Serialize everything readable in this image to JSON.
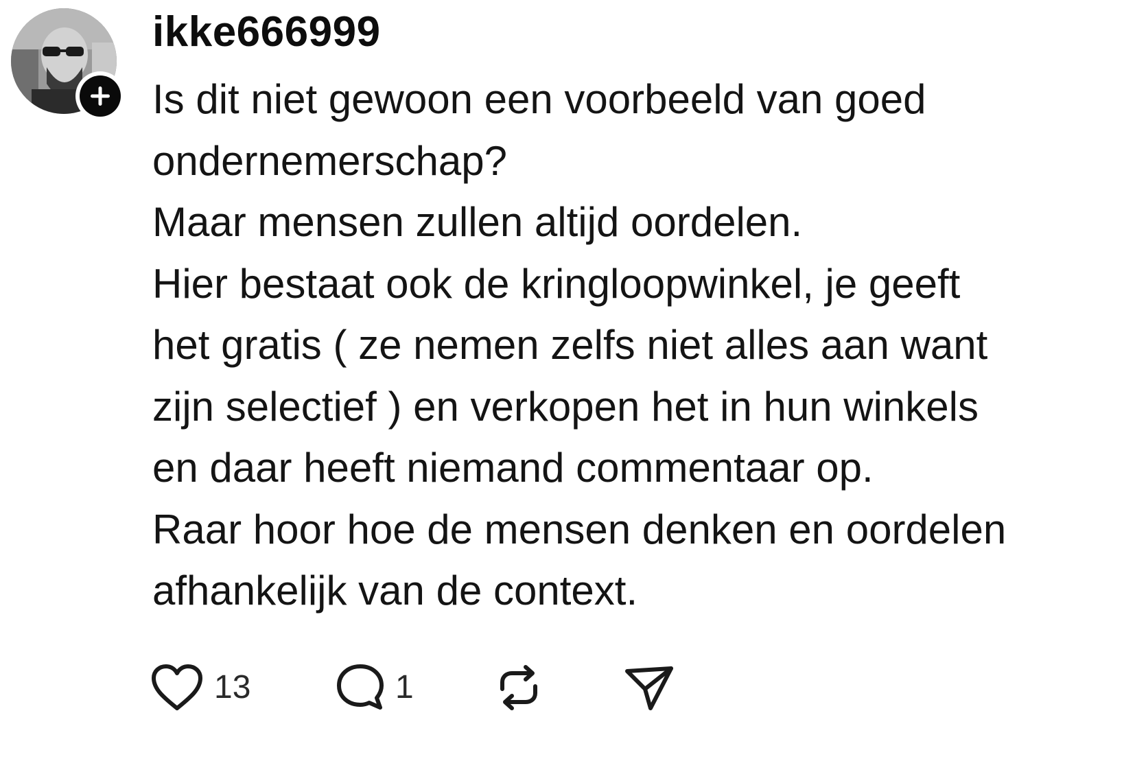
{
  "post": {
    "username": "ikke666999",
    "lines": [
      "Is dit niet gewoon een voorbeeld van goed",
      "ondernemerschap?",
      "Maar mensen zullen altijd oordelen.",
      "Hier bestaat ook de kringloopwinkel, je geeft",
      "het gratis ( ze nemen zelfs niet alles aan want",
      "zijn selectief ) en verkopen het in hun winkels",
      "en daar heeft niemand commentaar op.",
      "Raar hoor hoe de mensen denken en oordelen",
      "afhankelijk van de context."
    ]
  },
  "actions": {
    "like": {
      "icon": "heart-icon",
      "count": "13"
    },
    "comment": {
      "icon": "comment-bubble-icon",
      "count": "1"
    },
    "repost": {
      "icon": "repost-icon"
    },
    "share": {
      "icon": "send-icon"
    }
  },
  "colors": {
    "text": "#141414",
    "follow_badge": "#0a0a0a",
    "background": "#ffffff"
  }
}
